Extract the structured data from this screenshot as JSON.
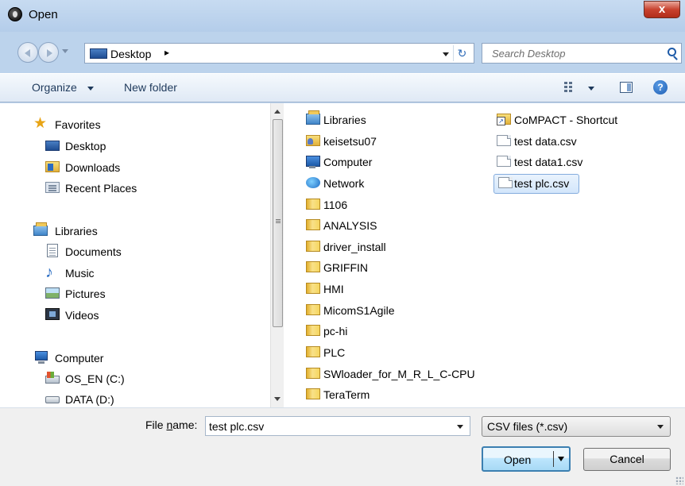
{
  "window": {
    "title": "Open",
    "close_label": "x"
  },
  "address": {
    "location": "Desktop",
    "chevron": "▸",
    "refresh_icon": "refresh-icon",
    "search_placeholder": "Search Desktop"
  },
  "toolbar": {
    "organize_label": "Organize",
    "new_folder_label": "New folder"
  },
  "nav": {
    "favorites": {
      "label": "Favorites",
      "items": [
        "Desktop",
        "Downloads",
        "Recent Places"
      ]
    },
    "libraries": {
      "label": "Libraries",
      "items": [
        "Documents",
        "Music",
        "Pictures",
        "Videos"
      ]
    },
    "computer": {
      "label": "Computer",
      "items": [
        "OS_EN (C:)",
        "DATA (D:)"
      ]
    }
  },
  "files": {
    "column1": [
      "Libraries",
      "keisetsu07",
      "Computer",
      "Network",
      "1106",
      "ANALYSIS",
      "driver_install",
      "GRIFFIN",
      "HMI",
      "MicomS1Agile",
      "pc-hi",
      "PLC",
      "SWloader_for_M_R_L_C-CPU",
      "TeraTerm"
    ],
    "column2": [
      "CoMPACT - Shortcut",
      "test data.csv",
      "test data1.csv",
      "test plc.csv"
    ],
    "selected": "test plc.csv"
  },
  "footer": {
    "file_name_label_prefix": "File ",
    "file_name_label_underlined": "n",
    "file_name_label_suffix": "ame:",
    "file_name_value": "test plc.csv",
    "file_type": "CSV files (*.csv)",
    "open_label": "Open",
    "cancel_label": "Cancel"
  },
  "colors": {
    "selection": "#d3e6fb",
    "accent": "#3c7fb1",
    "chrome": "#bcd3ec"
  }
}
